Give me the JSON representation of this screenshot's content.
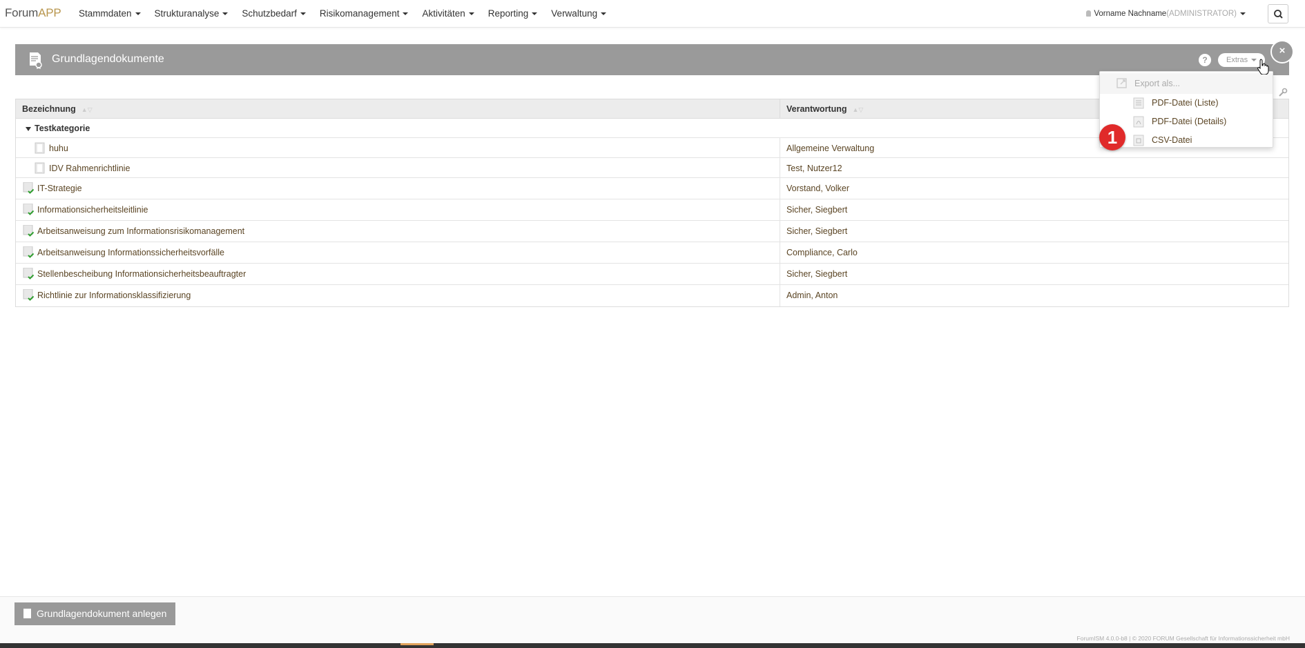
{
  "nav": {
    "brand_prefix": "Forum",
    "brand_suffix": "APP",
    "menu": [
      {
        "label": "Stammdaten"
      },
      {
        "label": "Strukturanalyse"
      },
      {
        "label": "Schutzbedarf"
      },
      {
        "label": "Risikomanagement"
      },
      {
        "label": "Aktivitäten"
      },
      {
        "label": "Reporting"
      },
      {
        "label": "Verwaltung"
      }
    ],
    "user_name": "Vorname Nachname",
    "user_role": "(ADMINISTRATOR)"
  },
  "panel": {
    "title": "Grundlagendokumente",
    "help_label": "?",
    "extras_label": "Extras",
    "close_label": "×"
  },
  "table": {
    "columns": [
      "Bezeichnung",
      "Verantwortung"
    ],
    "group_label": "Testkategorie",
    "group_rows": [
      {
        "name": "huhu",
        "owner": "Allgemeine Verwaltung"
      },
      {
        "name": "IDV Rahmenrichtlinie",
        "owner": "Test, Nutzer12"
      }
    ],
    "rows": [
      {
        "name": "IT-Strategie",
        "owner": "Vorstand, Volker"
      },
      {
        "name": "Informationsicherheitsleitlinie",
        "owner": "Sicher, Siegbert"
      },
      {
        "name": "Arbeitsanweisung zum Informationsrisikomanagement",
        "owner": "Sicher, Siegbert"
      },
      {
        "name": "Arbeitsanweisung Informationssicherheitsvorfälle",
        "owner": "Compliance, Carlo"
      },
      {
        "name": "Stellenbescheibung Informationsicherheitsbeauftragter",
        "owner": "Sicher, Siegbert"
      },
      {
        "name": "Richtlinie zur Informationsklassifizierung",
        "owner": "Admin, Anton"
      }
    ]
  },
  "dropdown": {
    "header": "Export als...",
    "items": [
      "PDF-Datei (Liste)",
      "PDF-Datei (Details)",
      "CSV-Datei"
    ]
  },
  "callout_number": "1",
  "footer": {
    "create_label": "Grundlagendokument anlegen",
    "copyright": "ForumISM 4.0.0-b8  |  © 2020 FORUM Gesellschaft für Informationssicherheit mbH"
  },
  "colors": {
    "panel_header": "#9a9a9a",
    "badge": "#e02a2a",
    "link_text": "#5a4423",
    "check": "#2e9e2e"
  }
}
